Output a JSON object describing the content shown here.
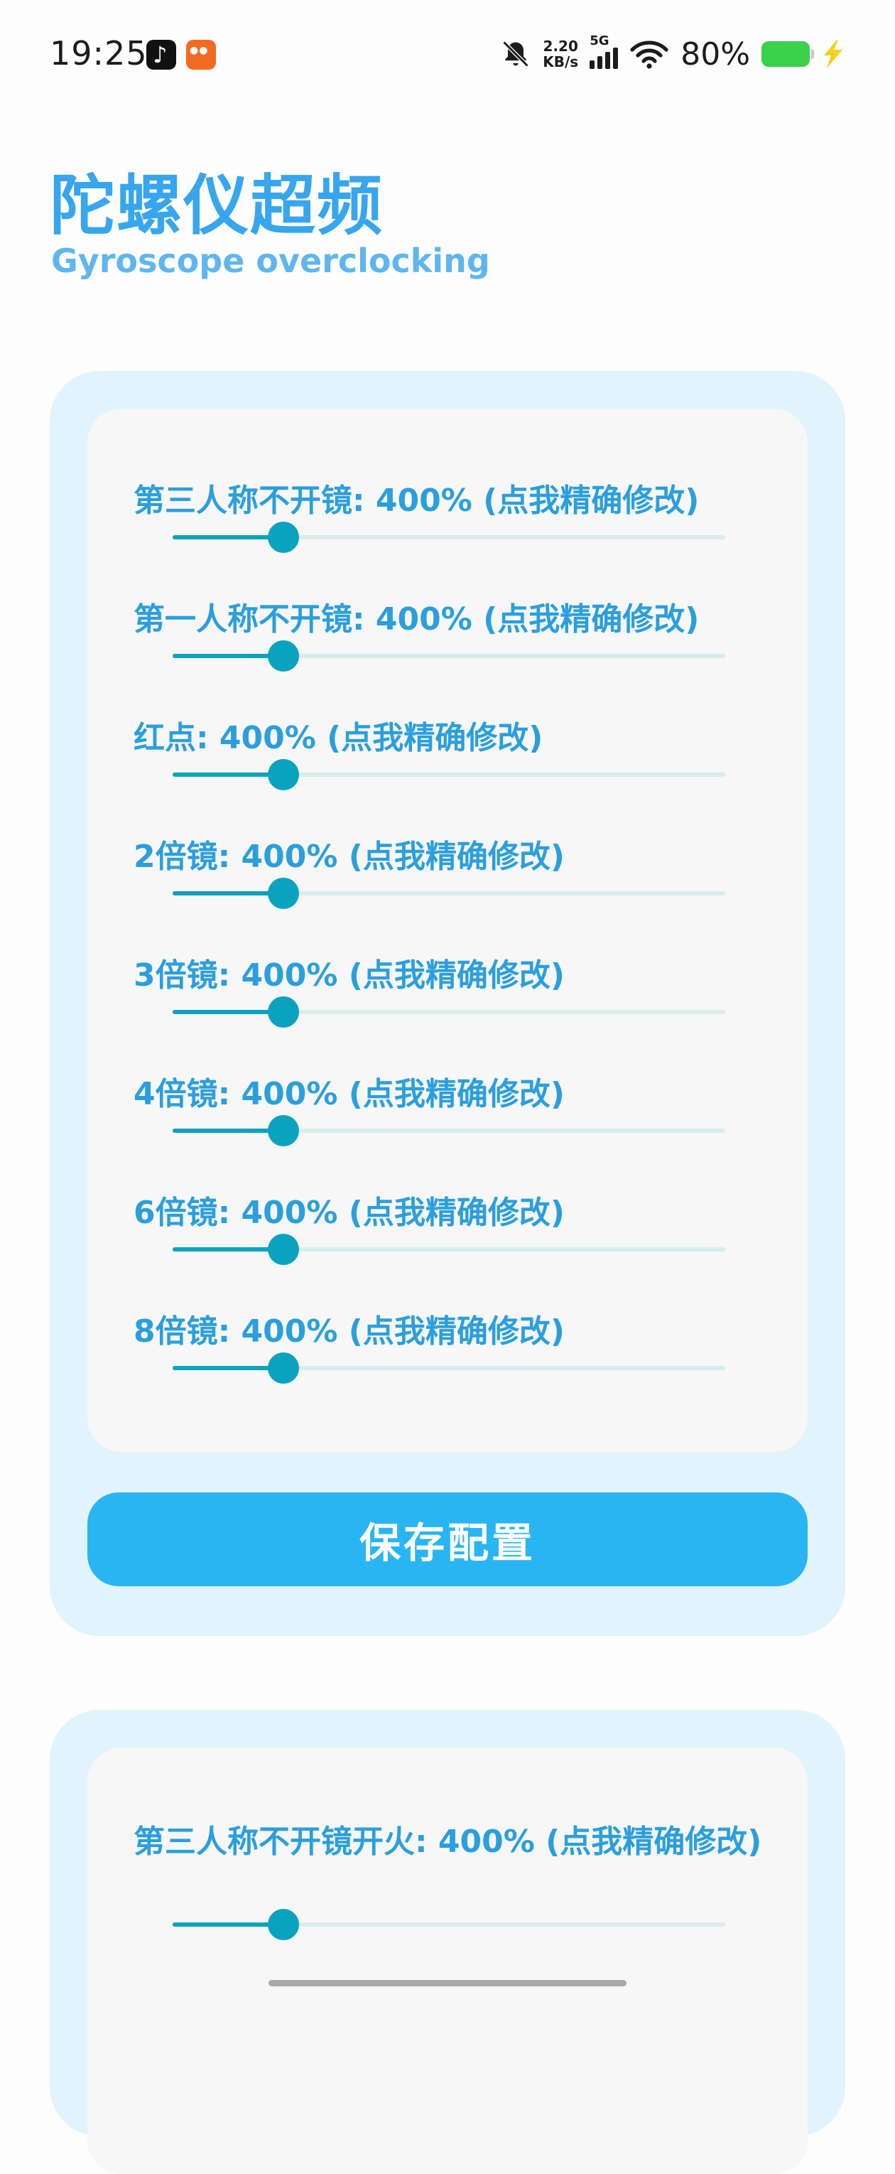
{
  "status_bar": {
    "time": "19:25",
    "net_speed_value": "2.20",
    "net_speed_unit": "KB/s",
    "network": "5G",
    "battery_percent": "80%",
    "battery_level": 0.8,
    "icons": [
      "tiktok-icon",
      "kuaishou-icon",
      "bell-muted-icon",
      "signal-icon",
      "wifi-icon",
      "battery-icon",
      "charging-icon"
    ]
  },
  "header": {
    "title": "陀螺仪超频",
    "subtitle": "Gyroscope overclocking"
  },
  "card1": {
    "sliders": [
      {
        "label": "第三人称不开镜: 400% (点我精确修改)",
        "value": 0.2
      },
      {
        "label": "第一人称不开镜: 400% (点我精确修改)",
        "value": 0.2
      },
      {
        "label": "红点: 400% (点我精确修改)",
        "value": 0.2
      },
      {
        "label": "2倍镜: 400% (点我精确修改)",
        "value": 0.2
      },
      {
        "label": "3倍镜: 400% (点我精确修改)",
        "value": 0.2
      },
      {
        "label": "4倍镜: 400% (点我精确修改)",
        "value": 0.2
      },
      {
        "label": "6倍镜: 400% (点我精确修改)",
        "value": 0.2
      },
      {
        "label": "8倍镜: 400% (点我精确修改)",
        "value": 0.2
      }
    ],
    "save_label": "保存配置"
  },
  "card2": {
    "sliders": [
      {
        "label": "第三人称不开镜开火: 400% (点我精确修改)",
        "value": 0.2
      }
    ]
  },
  "colors": {
    "title": "#37a6ee",
    "label": "#2b9fde",
    "slider": "#0aa3bf",
    "button": "#29b5f3",
    "card_outer": "#e1f3fc"
  }
}
